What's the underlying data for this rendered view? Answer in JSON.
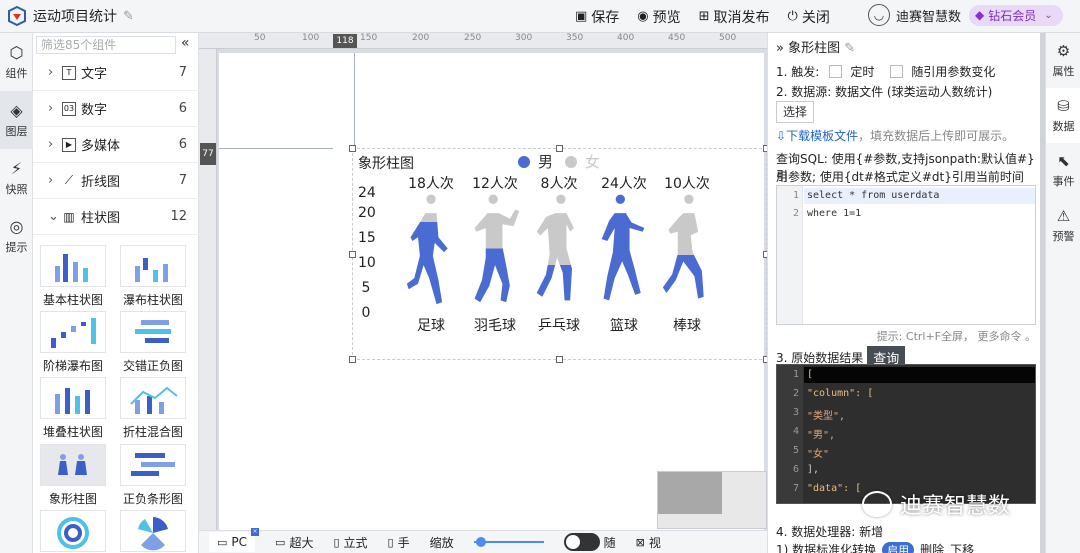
{
  "app": {
    "title": "运动项目统计"
  },
  "toolbar": {
    "save": "保存",
    "preview": "预览",
    "unpublish": "取消发布",
    "close": "关闭"
  },
  "user": {
    "name": "迪赛智慧数",
    "badge": "钻石会员"
  },
  "left_rail": {
    "items": [
      {
        "label": "组件",
        "icon": "cube-icon"
      },
      {
        "label": "图层",
        "icon": "layers-icon"
      },
      {
        "label": "快照",
        "icon": "snapshot-icon"
      },
      {
        "label": "提示",
        "icon": "bulb-icon"
      }
    ]
  },
  "component_panel": {
    "search_placeholder": "筛选85个组件",
    "categories": [
      {
        "label": "文字",
        "count": "7"
      },
      {
        "label": "数字",
        "count": "6"
      },
      {
        "label": "多媒体",
        "count": "6"
      },
      {
        "label": "折线图",
        "count": "7"
      },
      {
        "label": "柱状图",
        "count": "12"
      }
    ],
    "widgets": [
      "基本柱状图",
      "瀑布柱状图",
      "阶梯瀑布图",
      "交错正负图",
      "堆叠柱状图",
      "折柱混合图",
      "象形柱图",
      "正负条形图"
    ]
  },
  "canvas": {
    "ruler_marks": [
      "50",
      "100",
      "150",
      "200",
      "250",
      "300",
      "350",
      "400",
      "450",
      "500"
    ],
    "ruler_marker_x": "118",
    "ruler_marker_y": "77"
  },
  "chart_data": {
    "type": "bar",
    "title": "象形柱图",
    "categories": [
      "足球",
      "羽毛球",
      "乒乓球",
      "篮球",
      "棒球"
    ],
    "series": [
      {
        "name": "男",
        "values": [
          18,
          12,
          8,
          24,
          10
        ]
      },
      {
        "name": "女",
        "values": []
      }
    ],
    "data_labels": [
      "18人次",
      "12人次",
      "8人次",
      "24人次",
      "10人次"
    ],
    "y_ticks": [
      "24",
      "20",
      "15",
      "10",
      "5",
      "0"
    ],
    "ylim": [
      0,
      24
    ],
    "colors": {
      "男": "#4a6bd1",
      "女": "#c9c9c9"
    },
    "legend_position": "top"
  },
  "bottom_bar": {
    "pc": "PC",
    "xl": "超大",
    "stand": "立式",
    "hand": "手",
    "zoom": "缩放",
    "follow": "随",
    "view": "视"
  },
  "right_panel": {
    "title": "象形柱图",
    "trigger_label": "1. 触发:",
    "timer": "定时",
    "param_change": "随引用参数变化",
    "datasource": "2. 数据源:  数据文件  (球类运动人数统计)",
    "select_btn": "选择",
    "download": "下载模板文件",
    "download_hint": "，填充数据后上传即可展示。",
    "sql_help1": "查询SQL: 使用{#参数,支持jsonpath:默认值#}引",
    "sql_help2": "用参数; 使用{dt#格式定义#dt}引用当前时间",
    "code": [
      "select * from userdata",
      " where 1=1"
    ],
    "editor_hint": "提示: Ctrl+F全屏， 更多命令 。",
    "raw_result": "3. 原始数据结果",
    "query_btn": "查询",
    "json_lines": [
      "[",
      "  \"column\": [",
      "    \"类型\",",
      "    \"男\",",
      "    \"女\"",
      "  ],",
      "  \"data\": ["
    ],
    "processor": "4. 数据处理器: 新增",
    "proc1": "1) 数据标准化转换",
    "enable": "启用",
    "delete": "删除",
    "move_down": "下移"
  },
  "right_rail": {
    "items": [
      {
        "label": "属性",
        "icon": "settings-icon"
      },
      {
        "label": "数据",
        "icon": "database-icon"
      },
      {
        "label": "事件",
        "icon": "pointer-icon"
      },
      {
        "label": "预警",
        "icon": "alarm-icon"
      }
    ]
  },
  "watermark": {
    "text": "迪赛智慧数"
  }
}
